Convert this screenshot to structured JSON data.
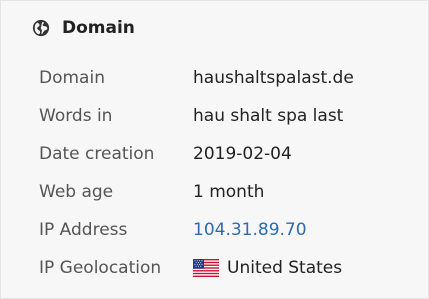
{
  "header": {
    "icon": "globe-icon",
    "title": "Domain"
  },
  "rows": [
    {
      "label": "Domain",
      "value": "haushaltspalast.de"
    },
    {
      "label": "Words in",
      "value": "hau shalt spa last"
    },
    {
      "label": "Date creation",
      "value": "2019-02-04"
    },
    {
      "label": "Web age",
      "value": "1 month"
    },
    {
      "label": "IP Address",
      "value": "104.31.89.70"
    },
    {
      "label": "IP Geolocation",
      "value": "United States",
      "icon": "us-flag-icon"
    }
  ],
  "colors": {
    "link": "#2b6bb0",
    "label": "#555555",
    "value": "#222222",
    "background": "#f7f7f7"
  }
}
